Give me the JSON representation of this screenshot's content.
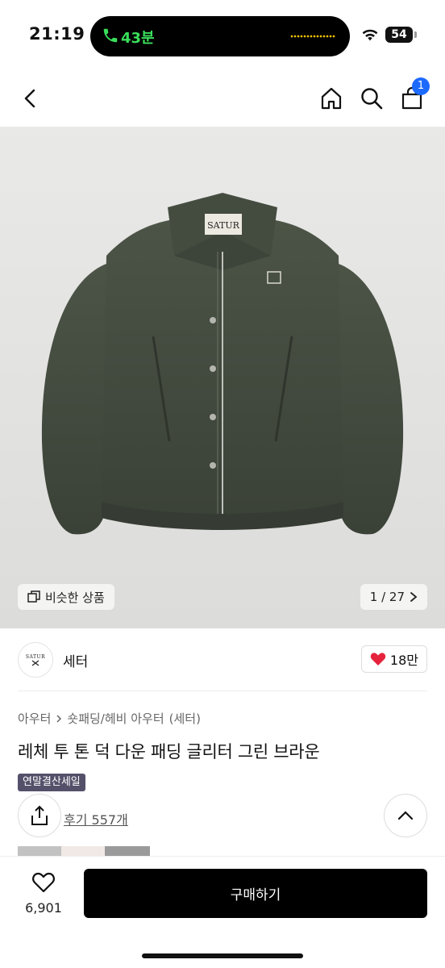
{
  "status_bar": {
    "time": "21:19",
    "call_duration": "43분",
    "battery": "54",
    "call_color": "#3adf5b"
  },
  "nav": {
    "back_icon": "chevron-left-icon",
    "home_icon": "home-icon",
    "search_icon": "search-icon",
    "cart_icon": "cart-icon",
    "cart_count": "1",
    "badge_color": "#1d6aff"
  },
  "gallery": {
    "logo_label": "SATUR",
    "similar_label": "비슷한 상품",
    "page_current": "1",
    "page_total": "27",
    "page_text": "1 / 27"
  },
  "brand": {
    "logo_text": "SATUR",
    "name": "세터",
    "like_count": "18만"
  },
  "product": {
    "breadcrumb_category": "아우터",
    "breadcrumb_sub": "숏패딩/헤비 아우터",
    "breadcrumb_brand": "(세터)",
    "title": "레체 투 톤 덕 다운 패딩 글리터 그린 브라운",
    "sale_tag": "연말결산세일",
    "review_link": "후기 557개"
  },
  "bottom_bar": {
    "wish_count": "6,901",
    "buy_label": "구매하기"
  }
}
